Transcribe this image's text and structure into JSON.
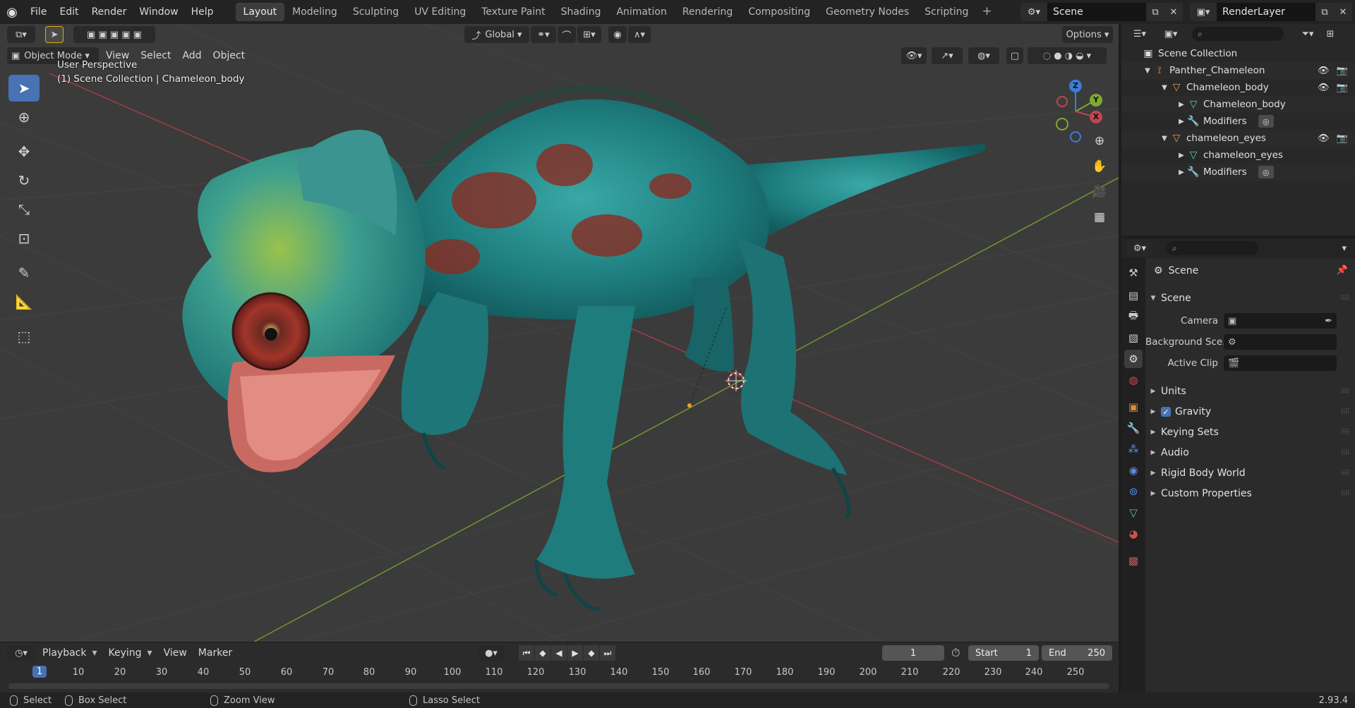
{
  "app": {
    "menus": [
      "File",
      "Edit",
      "Render",
      "Window",
      "Help"
    ],
    "workspaces": [
      "Layout",
      "Modeling",
      "Sculpting",
      "UV Editing",
      "Texture Paint",
      "Shading",
      "Animation",
      "Rendering",
      "Compositing",
      "Geometry Nodes",
      "Scripting"
    ],
    "active_workspace": "Layout",
    "scene_name": "Scene",
    "view_layer": "RenderLayer"
  },
  "viewport": {
    "transform_orientation": "Global",
    "options_label": "Options",
    "mode": "Object Mode",
    "menus": [
      "View",
      "Select",
      "Add",
      "Object"
    ],
    "overlay_line1": "User Perspective",
    "overlay_line2": "(1) Scene Collection | Chameleon_body",
    "gizmo_axes": {
      "z": "Z",
      "y": "Y",
      "x": "X"
    }
  },
  "timeline": {
    "menus": [
      "Playback",
      "Keying",
      "View",
      "Marker"
    ],
    "current_frame": "1",
    "start_label": "Start",
    "start_value": "1",
    "end_label": "End",
    "end_value": "250",
    "ticks": [
      "1",
      "10",
      "20",
      "30",
      "40",
      "50",
      "60",
      "70",
      "80",
      "90",
      "100",
      "110",
      "120",
      "130",
      "140",
      "150",
      "160",
      "170",
      "180",
      "190",
      "200",
      "210",
      "220",
      "230",
      "240",
      "250"
    ]
  },
  "statusbar": {
    "select": "Select",
    "box_select": "Box Select",
    "zoom_view": "Zoom View",
    "lasso_select": "Lasso Select",
    "version": "2.93.4"
  },
  "outliner": {
    "root": "Scene Collection",
    "items": [
      {
        "label": "Panther_Chameleon"
      },
      {
        "label": "Chameleon_body"
      },
      {
        "label": "Chameleon_body"
      },
      {
        "label": "Modifiers"
      },
      {
        "label": "chameleon_eyes"
      },
      {
        "label": "chameleon_eyes"
      },
      {
        "label": "Modifiers"
      }
    ]
  },
  "properties": {
    "breadcrumb": "Scene",
    "scene_panel": "Scene",
    "camera_label": "Camera",
    "background_label": "Background Sce...",
    "active_clip_label": "Active Clip",
    "panels": [
      "Units",
      "Gravity",
      "Keying Sets",
      "Audio",
      "Rigid Body World",
      "Custom Properties"
    ]
  },
  "colors": {
    "accent": "#4772b3",
    "axis_x": "#c0454f",
    "axis_y": "#7fa832",
    "axis_z": "#3a7dd8"
  }
}
